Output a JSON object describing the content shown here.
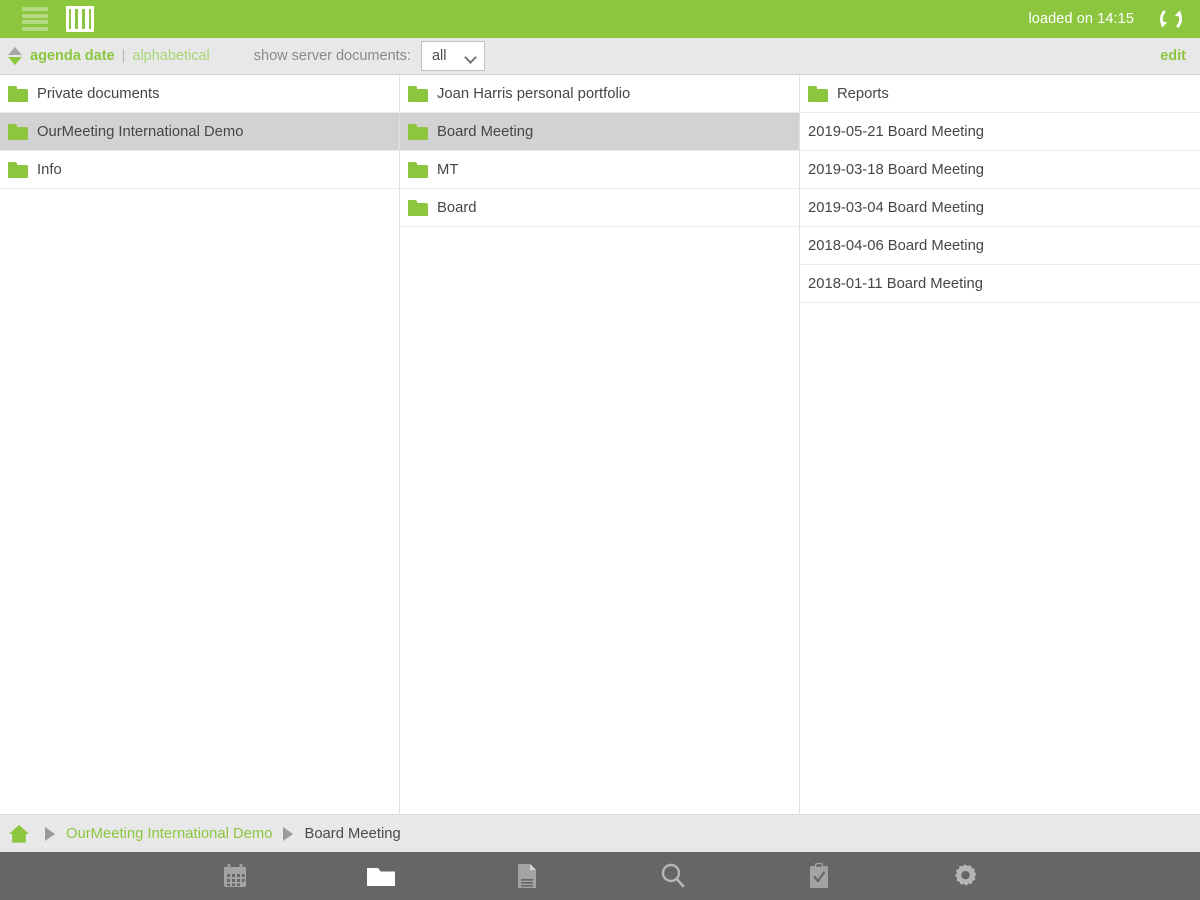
{
  "header": {
    "menu_icon": "hamburger-icon",
    "columns_icon": "columns-view-icon",
    "status_text": "loaded on 14:15",
    "refresh_icon": "refresh-icon",
    "background_color": "#8cc63f"
  },
  "filterbar": {
    "sort_toggle_icon": "sort-arrows-icon",
    "sort_primary": "agenda date",
    "sort_separator": "|",
    "sort_secondary": "alphabetical",
    "server_docs_label": "show server documents:",
    "server_docs_value": "all",
    "server_docs_options": [
      "all"
    ],
    "chevron_icon": "chevron-down-icon",
    "edit_label": "edit",
    "accent_color": "#8cc63f",
    "background_color": "#e8e8e8"
  },
  "columns": [
    {
      "name": "column-1",
      "rows": [
        {
          "label": "Private documents",
          "type": "folder",
          "selected": false
        },
        {
          "label": "OurMeeting International Demo",
          "type": "folder",
          "selected": true
        },
        {
          "label": "Info",
          "type": "folder",
          "selected": false
        }
      ]
    },
    {
      "name": "column-2",
      "rows": [
        {
          "label": "Joan Harris personal portfolio",
          "type": "folder",
          "selected": false
        },
        {
          "label": "Board Meeting",
          "type": "folder",
          "selected": true
        },
        {
          "label": "MT",
          "type": "folder",
          "selected": false
        },
        {
          "label": "Board",
          "type": "folder",
          "selected": false
        }
      ]
    },
    {
      "name": "column-3",
      "rows": [
        {
          "label": "Reports",
          "type": "folder",
          "selected": false
        },
        {
          "label": "2019-05-21 Board Meeting",
          "type": "document",
          "selected": false
        },
        {
          "label": "2019-03-18 Board Meeting",
          "type": "document",
          "selected": false
        },
        {
          "label": "2019-03-04 Board Meeting",
          "type": "document",
          "selected": false
        },
        {
          "label": "2018-04-06 Board Meeting",
          "type": "document",
          "selected": false
        },
        {
          "label": "2018-01-11 Board Meeting",
          "type": "document",
          "selected": false
        }
      ]
    }
  ],
  "breadcrumb": {
    "home_icon": "home-icon",
    "items": [
      {
        "label": "OurMeeting International Demo",
        "current": false
      },
      {
        "label": "Board Meeting",
        "current": true
      }
    ]
  },
  "navbar": {
    "background_color": "#666666",
    "items": [
      {
        "icon": "calendar-icon",
        "active": false
      },
      {
        "icon": "folder-icon",
        "active": true
      },
      {
        "icon": "document-icon",
        "active": false
      },
      {
        "icon": "search-icon",
        "active": false
      },
      {
        "icon": "tasks-clipboard-icon",
        "active": false
      },
      {
        "icon": "gear-icon",
        "active": false
      }
    ]
  }
}
